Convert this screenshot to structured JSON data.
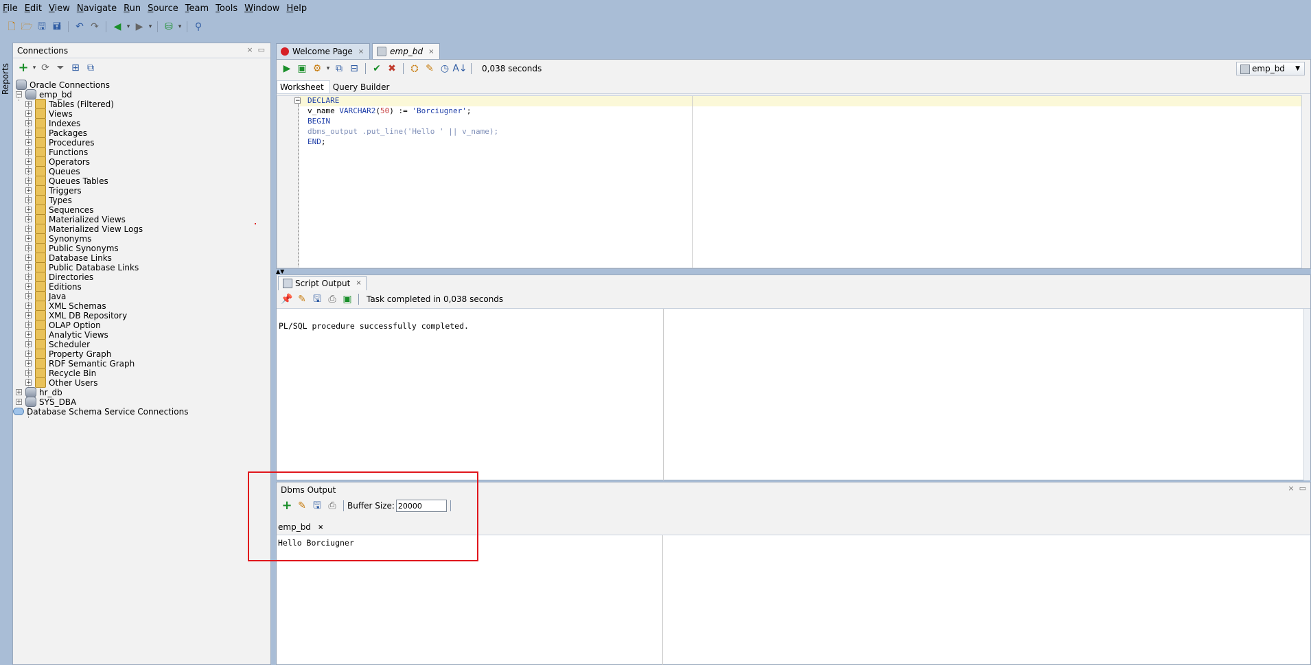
{
  "menubar": {
    "items": [
      "File",
      "Edit",
      "View",
      "Navigate",
      "Run",
      "Source",
      "Team",
      "Tools",
      "Window",
      "Help"
    ]
  },
  "side_strip": {
    "reports_label": "Reports"
  },
  "connections": {
    "title": "Connections",
    "tree": {
      "root": "Oracle Connections",
      "connection": "emp_bd",
      "children": [
        "Tables (Filtered)",
        "Views",
        "Indexes",
        "Packages",
        "Procedures",
        "Functions",
        "Operators",
        "Queues",
        "Queues Tables",
        "Triggers",
        "Types",
        "Sequences",
        "Materialized Views",
        "Materialized View Logs",
        "Synonyms",
        "Public Synonyms",
        "Database Links",
        "Public Database Links",
        "Directories",
        "Editions",
        "Java",
        "XML Schemas",
        "XML DB Repository",
        "OLAP Option",
        "Analytic Views",
        "Scheduler",
        "Property Graph",
        "RDF Semantic Graph",
        "Recycle Bin",
        "Other Users"
      ],
      "other_connections": [
        "hr_db",
        "SYS_DBA"
      ],
      "cloud_root": "Database Schema Service Connections"
    }
  },
  "editor": {
    "tabs": [
      {
        "label": "Welcome Page",
        "active": false
      },
      {
        "label": "emp_bd",
        "active": true
      }
    ],
    "toolbar_time": "0,038 seconds",
    "connection_selector": "emp_bd",
    "subtabs": [
      "Worksheet",
      "Query Builder"
    ],
    "code": {
      "l1_kw": "DECLARE",
      "l2_ident": "v_name ",
      "l2_type": "VARCHAR2",
      "l2_open": "(",
      "l2_num": "50",
      "l2_close": ") := ",
      "l2_str": "'Borciugner'",
      "l2_end": ";",
      "l3_kw": "BEGIN",
      "l4_text": "dbms_output .put_line('Hello ' || v_name);",
      "l5_kw": "END",
      "l5_end": ";"
    }
  },
  "script_output": {
    "tab_label": "Script Output",
    "status": "Task completed in 0,038 seconds",
    "text": "PL/SQL procedure successfully completed."
  },
  "dbms_output": {
    "title": "Dbms Output",
    "buffer_label": "Buffer Size:",
    "buffer_value": "20000",
    "tab_label": "emp_bd",
    "text": "Hello Borciugner"
  },
  "colors": {
    "chrome_blue": "#a9bdd6",
    "panel_bg": "#f2f2f2",
    "highlight_red": "#e0161c",
    "keyword_blue": "#1f3fa8"
  }
}
